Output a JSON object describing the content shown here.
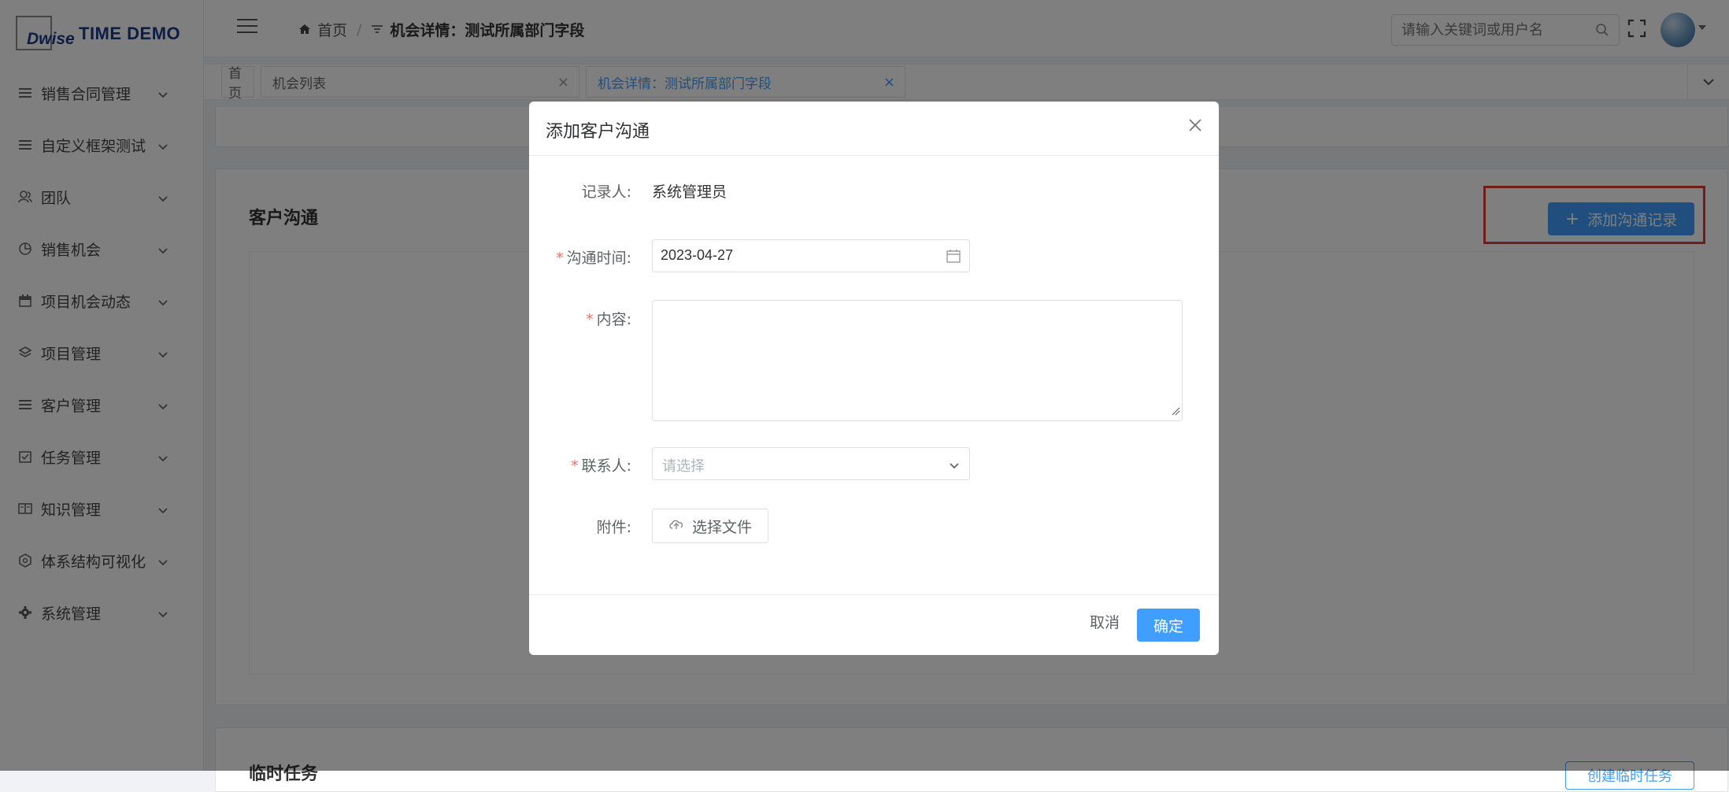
{
  "logo": {
    "mark": "Dwise",
    "text": "TIME DEMO"
  },
  "sidebar": {
    "items": [
      {
        "label": "销售合同管理",
        "icon": "list-icon"
      },
      {
        "label": "自定义框架测试",
        "icon": "list-icon"
      },
      {
        "label": "团队",
        "icon": "team-icon"
      },
      {
        "label": "销售机会",
        "icon": "pie-chart-icon"
      },
      {
        "label": "项目机会动态",
        "icon": "calendar-icon"
      },
      {
        "label": "项目管理",
        "icon": "layers-icon"
      },
      {
        "label": "客户管理",
        "icon": "list-icon"
      },
      {
        "label": "任务管理",
        "icon": "checkbox-icon"
      },
      {
        "label": "知识管理",
        "icon": "book-icon"
      },
      {
        "label": "体系结构可视化",
        "icon": "structure-icon"
      },
      {
        "label": "系统管理",
        "icon": "gear-icon"
      }
    ]
  },
  "header": {
    "breadcrumb_home": "首页",
    "breadcrumb_sep": "/",
    "breadcrumb_current": "机会详情：测试所属部门字段",
    "search_placeholder": "请输入关键词或用户名"
  },
  "tabs": [
    {
      "label": "首页"
    },
    {
      "label": "机会列表"
    },
    {
      "label": "机会详情：测试所属部门字段"
    }
  ],
  "main": {
    "comm_title": "客户沟通",
    "add_button": "添加沟通记录",
    "task_title": "临时任务",
    "task_button": "创建临时任务"
  },
  "dialog": {
    "title": "添加客户沟通",
    "recorder_label": "记录人:",
    "recorder_value": "系统管理员",
    "time_label": "沟通时间:",
    "time_value": "2023-04-27",
    "content_label": "内容:",
    "contact_label": "联系人:",
    "contact_placeholder": "请选择",
    "attachment_label": "附件:",
    "file_button": "选择文件",
    "cancel": "取消",
    "ok": "确定",
    "required_mark": "*"
  },
  "colors": {
    "primary": "#409eff",
    "highlight": "#e53935",
    "required": "#f56c6c"
  }
}
